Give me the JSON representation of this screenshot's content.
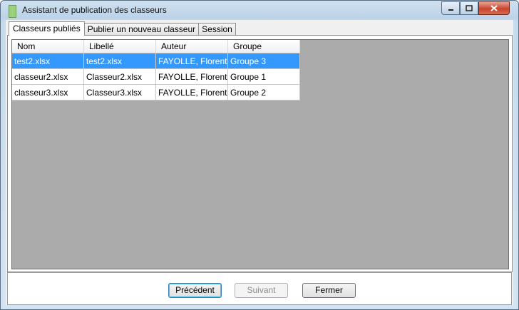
{
  "window": {
    "title": "Assistant de publication des classeurs"
  },
  "tabs": [
    {
      "label": "Classeurs publiés",
      "active": true
    },
    {
      "label": "Publier un nouveau classeur",
      "active": false
    },
    {
      "label": "Session",
      "active": false
    }
  ],
  "grid": {
    "columns": [
      "Nom",
      "Libellé",
      "Auteur",
      "Groupe"
    ],
    "rows": [
      {
        "cells": [
          "test2.xlsx",
          "test2.xlsx",
          "FAYOLLE, Florent",
          "Groupe 3"
        ],
        "selected": true
      },
      {
        "cells": [
          "classeur2.xlsx",
          "Classeur2.xlsx",
          "FAYOLLE, Florent",
          "Groupe 1"
        ],
        "selected": false
      },
      {
        "cells": [
          "classeur3.xlsx",
          "Classeur3.xlsx",
          "FAYOLLE, Florent",
          "Groupe 2"
        ],
        "selected": false
      }
    ]
  },
  "buttons": {
    "previous": "Précédent",
    "next": "Suivant",
    "close": "Fermer"
  },
  "colors": {
    "selection": "#3399ff",
    "grid_background": "#ababab"
  }
}
